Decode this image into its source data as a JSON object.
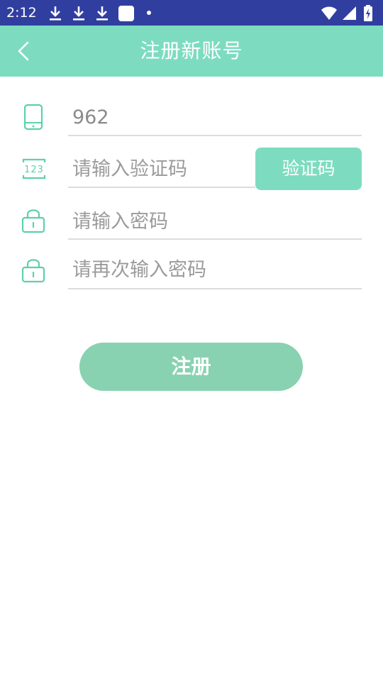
{
  "status_bar": {
    "time": "2:12",
    "left_icons": [
      "download-icon",
      "download-icon",
      "download-icon",
      "app-square-icon",
      "dot-icon"
    ],
    "right_icons": [
      "wifi-icon",
      "signal-icon",
      "battery-charging-icon"
    ]
  },
  "header": {
    "title": "注册新账号",
    "back_icon": "chevron-left-icon"
  },
  "form": {
    "phone": {
      "icon": "phone-icon",
      "value": "962",
      "placeholder": ""
    },
    "code": {
      "icon": "code-123-icon",
      "value": "",
      "placeholder": "请输入验证码",
      "badge_text": "123"
    },
    "code_button_label": "验证码",
    "password": {
      "icon": "lock-icon",
      "value": "",
      "placeholder": "请输入密码"
    },
    "confirm_password": {
      "icon": "lock-icon",
      "value": "",
      "placeholder": "请再次输入密码"
    }
  },
  "register_button_label": "注册",
  "colors": {
    "status_bar": "#303f9f",
    "accent": "#7ddcbf",
    "register_button": "#88d2b1",
    "icon_stroke": "#5ed0aa",
    "divider": "#dcdcdc",
    "placeholder_text": "#9b9b9b"
  }
}
